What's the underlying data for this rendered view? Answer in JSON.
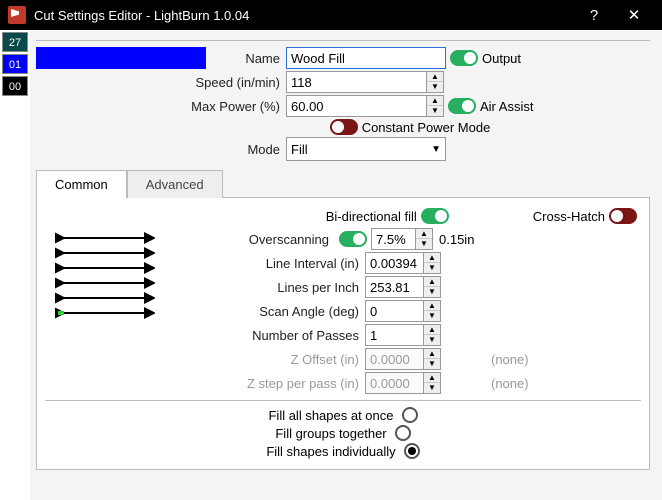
{
  "window": {
    "title": "Cut Settings Editor - LightBurn 1.0.04",
    "help": "?",
    "close": "✕"
  },
  "palette": [
    {
      "label": "27",
      "bg": "#0a4a4a"
    },
    {
      "label": "01",
      "bg": "#0000ff"
    },
    {
      "label": "00",
      "bg": "#000000"
    }
  ],
  "top": {
    "name_lbl": "Name",
    "name_val": "Wood Fill",
    "output_lbl": "Output",
    "speed_lbl": "Speed (in/min)",
    "speed_val": "118",
    "maxpower_lbl": "Max Power (%)",
    "maxpower_val": "60.00",
    "airassist_lbl": "Air Assist",
    "constpower_lbl": "Constant Power Mode",
    "mode_lbl": "Mode",
    "mode_val": "Fill"
  },
  "tabs": {
    "common": "Common",
    "advanced": "Advanced"
  },
  "common": {
    "bidir_lbl": "Bi-directional fill",
    "cross_lbl": "Cross-Hatch",
    "overscan_lbl": "Overscanning",
    "overscan_pct": "7.5%",
    "overscan_in": "0.15in",
    "lineint_lbl": "Line Interval (in)",
    "lineint_val": "0.00394",
    "lpi_lbl": "Lines per Inch",
    "lpi_val": "253.81",
    "angle_lbl": "Scan Angle (deg)",
    "angle_val": "0",
    "passes_lbl": "Number of Passes",
    "passes_val": "1",
    "zoff_lbl": "Z Offset (in)",
    "zoff_val": "0.0000",
    "zoff_note": "(none)",
    "zstep_lbl": "Z step per pass (in)",
    "zstep_val": "0.0000",
    "zstep_note": "(none)"
  },
  "fillmode": {
    "all": "Fill all shapes at once",
    "groups": "Fill groups together",
    "indiv": "Fill shapes individually"
  }
}
